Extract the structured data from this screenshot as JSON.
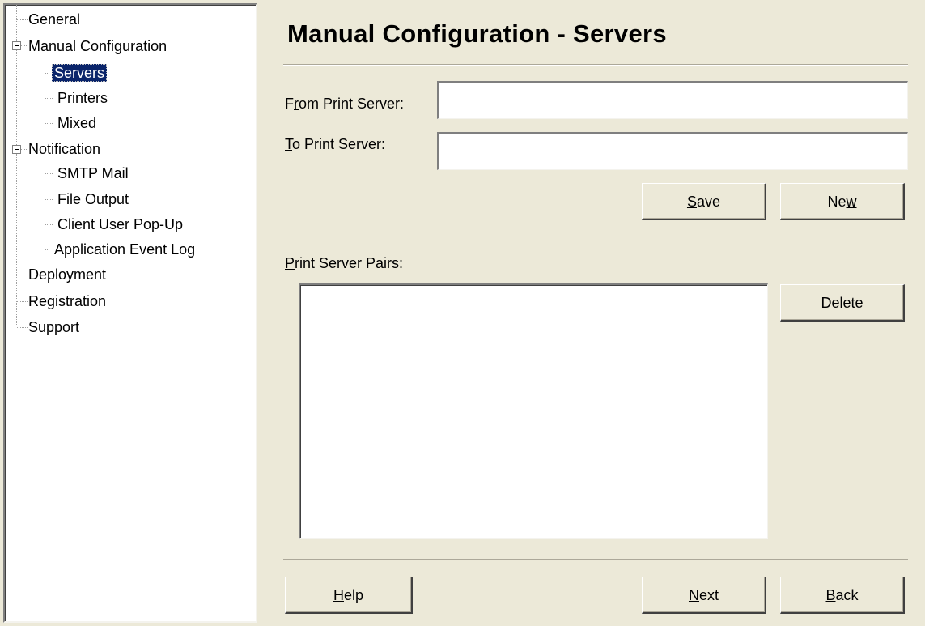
{
  "tree": {
    "items": [
      {
        "label": "General",
        "level": 0
      },
      {
        "label": "Manual Configuration",
        "level": 0,
        "expanded": true
      },
      {
        "label": "Servers",
        "level": 1,
        "selected": true
      },
      {
        "label": "Printers",
        "level": 1
      },
      {
        "label": "Mixed",
        "level": 1
      },
      {
        "label": "Notification",
        "level": 0,
        "expanded": true
      },
      {
        "label": "SMTP Mail",
        "level": 1
      },
      {
        "label": "File Output",
        "level": 1
      },
      {
        "label": "Client User Pop-Up",
        "level": 1
      },
      {
        "label": "Application Event Log",
        "level": 1
      },
      {
        "label": "Deployment",
        "level": 0
      },
      {
        "label": "Registration",
        "level": 0
      },
      {
        "label": "Support",
        "level": 0
      }
    ]
  },
  "page": {
    "title": "Manual Configuration - Servers"
  },
  "form": {
    "from_label": {
      "pre": "F",
      "key": "r",
      "post": "om Print Server:"
    },
    "from_value": "",
    "to_label": {
      "pre": "",
      "key": "T",
      "post": "o Print Server:"
    },
    "to_value": "",
    "pairs_label": {
      "pre": "",
      "key": "P",
      "post": "rint Server Pairs:"
    }
  },
  "buttons": {
    "save": {
      "pre": "",
      "key": "S",
      "post": "ave"
    },
    "new": {
      "pre": "Ne",
      "key": "w",
      "post": ""
    },
    "delete": {
      "pre": "",
      "key": "D",
      "post": "elete"
    },
    "help": {
      "pre": "",
      "key": "H",
      "post": "elp"
    },
    "next": {
      "pre": "",
      "key": "N",
      "post": "ext"
    },
    "back": {
      "pre": "",
      "key": "B",
      "post": "ack"
    }
  }
}
